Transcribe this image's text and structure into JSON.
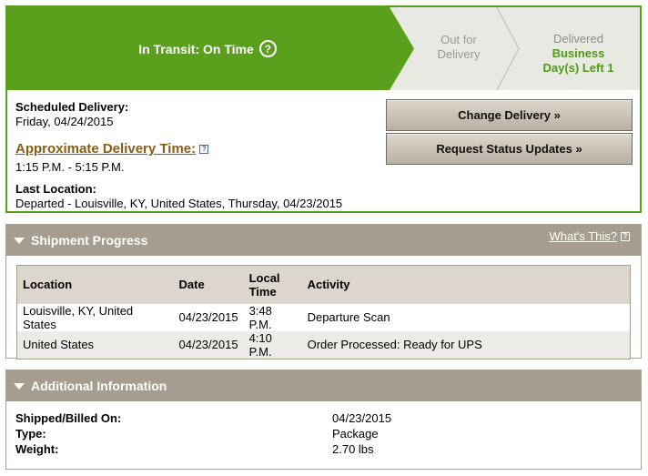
{
  "status": {
    "current_step": "In Transit: On Time",
    "help_glyph": "?",
    "out_for_delivery_line1": "Out for",
    "out_for_delivery_line2": "Delivery",
    "delivered_label": "Delivered",
    "business_line1": "Business",
    "business_line2": "Day(s) Left 1",
    "colors": {
      "accent": "#5ba01c",
      "pending": "#e9e9e4"
    }
  },
  "delivery": {
    "scheduled_label": "Scheduled Delivery:",
    "scheduled_value": "Friday, 04/24/2015",
    "approx_label": "Approximate Delivery Time:",
    "approx_value": "1:15 P.M. - 5:15 P.M.",
    "last_location_label": "Last Location:",
    "last_location_value": "Departed - Louisville, KY, United States, Thursday, 04/23/2015",
    "change_button": "Change Delivery »",
    "request_button": "Request Status Updates »"
  },
  "shipment_progress": {
    "title": "Shipment Progress",
    "whats_this": "What's This?",
    "columns": [
      "Location",
      "Date",
      "Local Time",
      "Activity"
    ],
    "rows": [
      {
        "location": "Louisville, KY, United States",
        "date": "04/23/2015",
        "time": "3:48 P.M.",
        "activity": "Departure Scan"
      },
      {
        "location": "United States",
        "date": "04/23/2015",
        "time": "4:10 P.M.",
        "activity": "Order Processed: Ready for UPS"
      }
    ]
  },
  "additional_info": {
    "title": "Additional Information",
    "shipped_label": "Shipped/Billed On:",
    "shipped_value": "04/23/2015",
    "type_label": "Type:",
    "type_value": "Package",
    "weight_label": "Weight:",
    "weight_value": "2.70 lbs"
  }
}
